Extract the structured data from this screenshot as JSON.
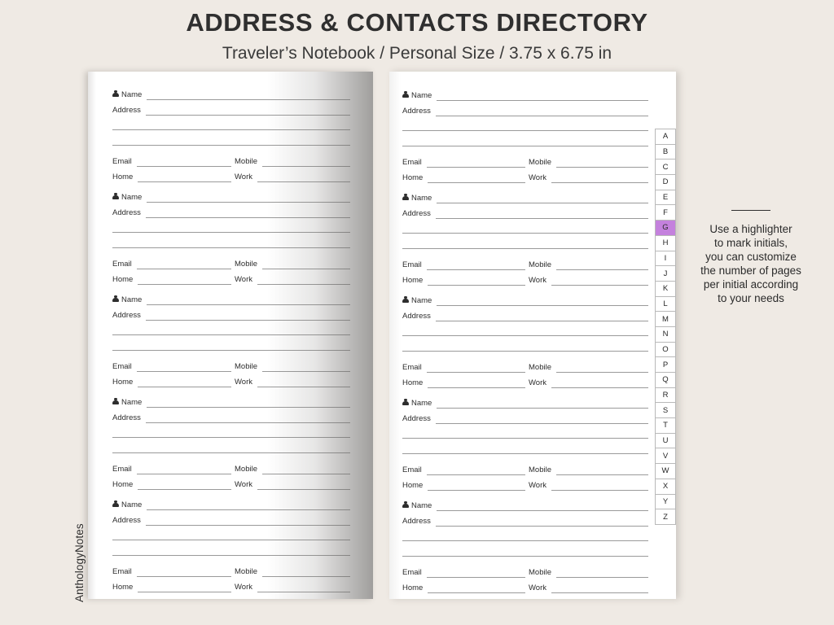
{
  "header": {
    "title": "ADDRESS & CONTACTS DIRECTORY",
    "subtitle": "Traveler’s Notebook / Personal Size / 3.75 x 6.75 in"
  },
  "contact_block": {
    "name_label": "Name",
    "name_icon": "person-icon",
    "address_label": "Address",
    "email_label": "Email",
    "mobile_label": "Mobile",
    "home_label": "Home",
    "work_label": "Work",
    "address_extra_lines": 2
  },
  "pages": {
    "left": {
      "blocks": 5
    },
    "right": {
      "blocks": 5
    }
  },
  "alphabet_tabs": {
    "letters": [
      "A",
      "B",
      "C",
      "D",
      "E",
      "F",
      "G",
      "H",
      "I",
      "J",
      "K",
      "L",
      "M",
      "N",
      "O",
      "P",
      "Q",
      "R",
      "S",
      "T",
      "U",
      "V",
      "W",
      "X",
      "Y",
      "Z"
    ],
    "active_letter": "G",
    "highlight_color": "#c481dd"
  },
  "side_note": {
    "text": "Use a highlighter to mark initials, you can customize the number of pages per initial according to your needs",
    "lines": [
      "Use a highlighter",
      "to mark initials,",
      "you can customize",
      "the number of pages",
      "per initial according",
      "to your needs"
    ]
  },
  "watermark": {
    "text": "AnthologyNotes"
  },
  "colors": {
    "background": "#efeae4",
    "page": "#ffffff",
    "text": "#2d2d2d",
    "rule": "#9a9a9a",
    "highlight": "#c481dd"
  }
}
